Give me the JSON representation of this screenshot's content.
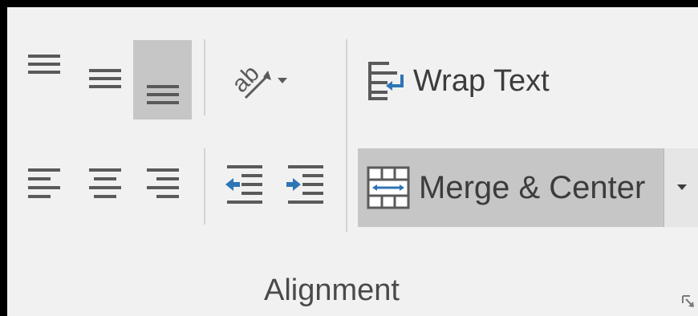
{
  "group": {
    "name": "Alignment",
    "dialog_launcher_icon": "dialog-launcher-icon"
  },
  "buttons": {
    "top_align": {
      "icon": "top-align-icon",
      "active": false
    },
    "middle_align": {
      "icon": "middle-align-icon",
      "active": false
    },
    "bottom_align": {
      "icon": "bottom-align-icon",
      "active": true
    },
    "orientation": {
      "icon": "text-orientation-icon",
      "dropdown_icon": "chevron-down-icon"
    },
    "align_left": {
      "icon": "align-left-icon"
    },
    "center": {
      "icon": "align-center-icon"
    },
    "align_right": {
      "icon": "align-right-icon"
    },
    "decrease_indent": {
      "icon": "decrease-indent-icon"
    },
    "increase_indent": {
      "icon": "increase-indent-icon"
    },
    "wrap_text": {
      "label": "Wrap Text",
      "icon": "wrap-text-icon"
    },
    "merge_center": {
      "label": "Merge & Center",
      "icon": "merge-cells-icon",
      "dropdown_icon": "chevron-down-icon",
      "active": true
    }
  },
  "colors": {
    "background": "#f1f1f1",
    "active": "#c6c6c6",
    "icon_gray": "#5a5a5a",
    "icon_blue": "#2e75b6",
    "text": "#3c3c3c"
  }
}
